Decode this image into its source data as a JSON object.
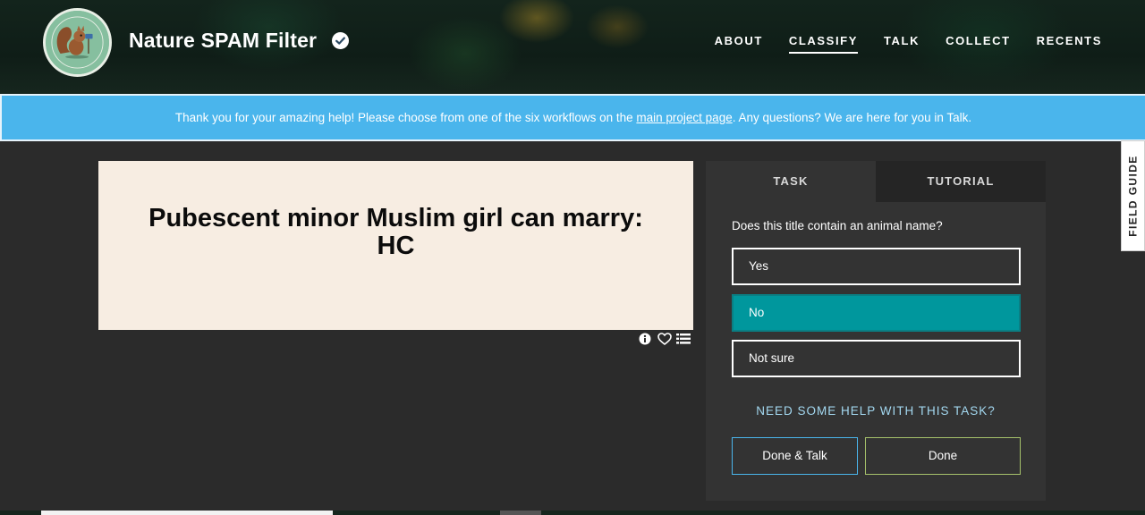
{
  "header": {
    "logo_icon": "squirrel-logo-icon",
    "site_title": "Nature SPAM Filter",
    "verified_icon": "verified-badge-icon",
    "nav": [
      {
        "label": "ABOUT",
        "active": false
      },
      {
        "label": "CLASSIFY",
        "active": true
      },
      {
        "label": "TALK",
        "active": false
      },
      {
        "label": "COLLECT",
        "active": false
      },
      {
        "label": "RECENTS",
        "active": false
      }
    ]
  },
  "banner": {
    "text_before": "Thank you for your amazing help! Please choose from one of the six workflows on the ",
    "link_text": "main project page",
    "text_after": ". Any questions? We are here for you in Talk."
  },
  "subject": {
    "title": "Pubescent minor Muslim girl can marry: HC",
    "tools": [
      "info-icon",
      "heart-icon",
      "collection-list-icon"
    ]
  },
  "task_panel": {
    "tabs": [
      {
        "label": "TASK",
        "active": true
      },
      {
        "label": "TUTORIAL",
        "active": false
      }
    ],
    "question": "Does this title contain an animal name?",
    "answers": [
      {
        "label": "Yes",
        "selected": false
      },
      {
        "label": "No",
        "selected": true
      },
      {
        "label": "Not sure",
        "selected": false
      }
    ],
    "help_link": "NEED SOME HELP WITH THIS TASK?",
    "done_talk_label": "Done & Talk",
    "done_label": "Done"
  },
  "field_guide": {
    "label": "FIELD GUIDE"
  },
  "colors": {
    "banner": "#4ab5ec",
    "selected_answer": "#00979d",
    "subject_bg": "#f7ede2",
    "panel_bg": "#333333",
    "page_bg": "#2b2b2b"
  }
}
